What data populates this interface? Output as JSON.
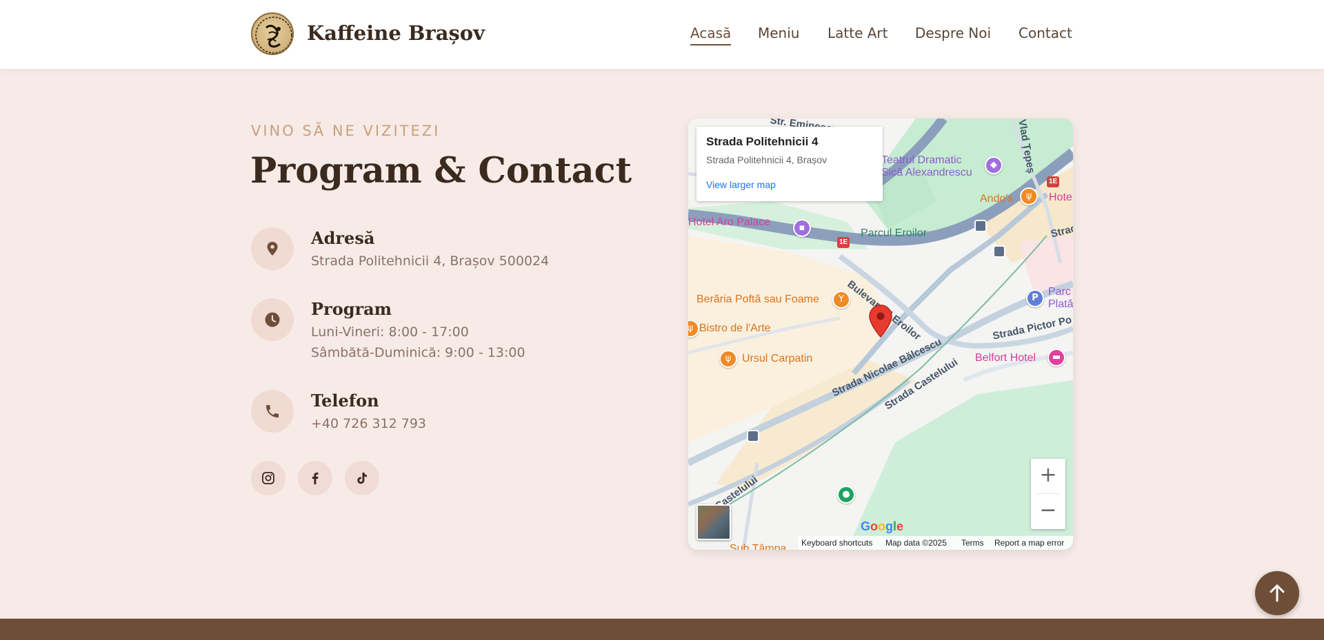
{
  "header": {
    "brand": "Kaffeine Brașov",
    "nav": [
      {
        "label": "Acasă",
        "active": true
      },
      {
        "label": "Meniu"
      },
      {
        "label": "Latte Art"
      },
      {
        "label": "Despre Noi"
      },
      {
        "label": "Contact"
      }
    ]
  },
  "contact": {
    "eyebrow": "VINO SĂ NE VIZITEZI",
    "title": "Program & Contact",
    "address": {
      "icon": "location-pin-icon",
      "heading": "Adresă",
      "text": "Strada Politehnicii 4, Brașov 500024"
    },
    "hours": {
      "icon": "clock-icon",
      "heading": "Program",
      "lines": [
        "Luni-Vineri: 8:00 - 17:00",
        "Sâmbătă-Duminică: 9:00 - 13:00"
      ]
    },
    "phone": {
      "icon": "phone-icon",
      "heading": "Telefon",
      "text": "+40 726 312 793"
    },
    "social": [
      "instagram-icon",
      "facebook-icon",
      "tiktok-icon"
    ]
  },
  "map": {
    "card": {
      "title": "Strada Politehnicii 4",
      "address": "Strada Politehnicii 4, Brașov",
      "link": "View larger map"
    },
    "labels": {
      "teatrul_1": "Teatrul Dramatic",
      "teatrul_2": "Sică Alexandrescu",
      "andos": "Ando's",
      "hotel_edge": "Hote",
      "aro": "Hotel Aro Palace",
      "parc_eroilor": "Parcul Eroilor",
      "bulevardul": "Bulevardul Eroilor",
      "beraria": "Berăria Poftă sau Foame",
      "bistro": "Bistro de l'Arte",
      "ursul": "Ursul Carpatin",
      "nicolae": "Strada Nicolae Bălcescu",
      "castelului": "Strada Castelului",
      "castelului2": "Castelului",
      "pictor": "Strada Pictor Po",
      "belfort": "Belfort Hotel",
      "parc_plata_1": "Parc",
      "parc_plata_2": "Plată",
      "strad_edge": "Strad",
      "vlad": "Vlad Țepeș",
      "eminescu": "Str. Eminescu",
      "sub_tampa": "Sub Tâmpa",
      "route_badge": "1E"
    },
    "zoom_in": "+",
    "zoom_out": "−",
    "google": "Google",
    "footer": {
      "shortcuts": "Keyboard shortcuts",
      "data": "Map data ©2025",
      "terms": "Terms",
      "report": "Report a map error"
    }
  },
  "colors": {
    "accent": "#6e4e37",
    "background": "#f7ebe8",
    "eyebrow": "#c9a07a",
    "icon_bg": "#f0dad2"
  }
}
